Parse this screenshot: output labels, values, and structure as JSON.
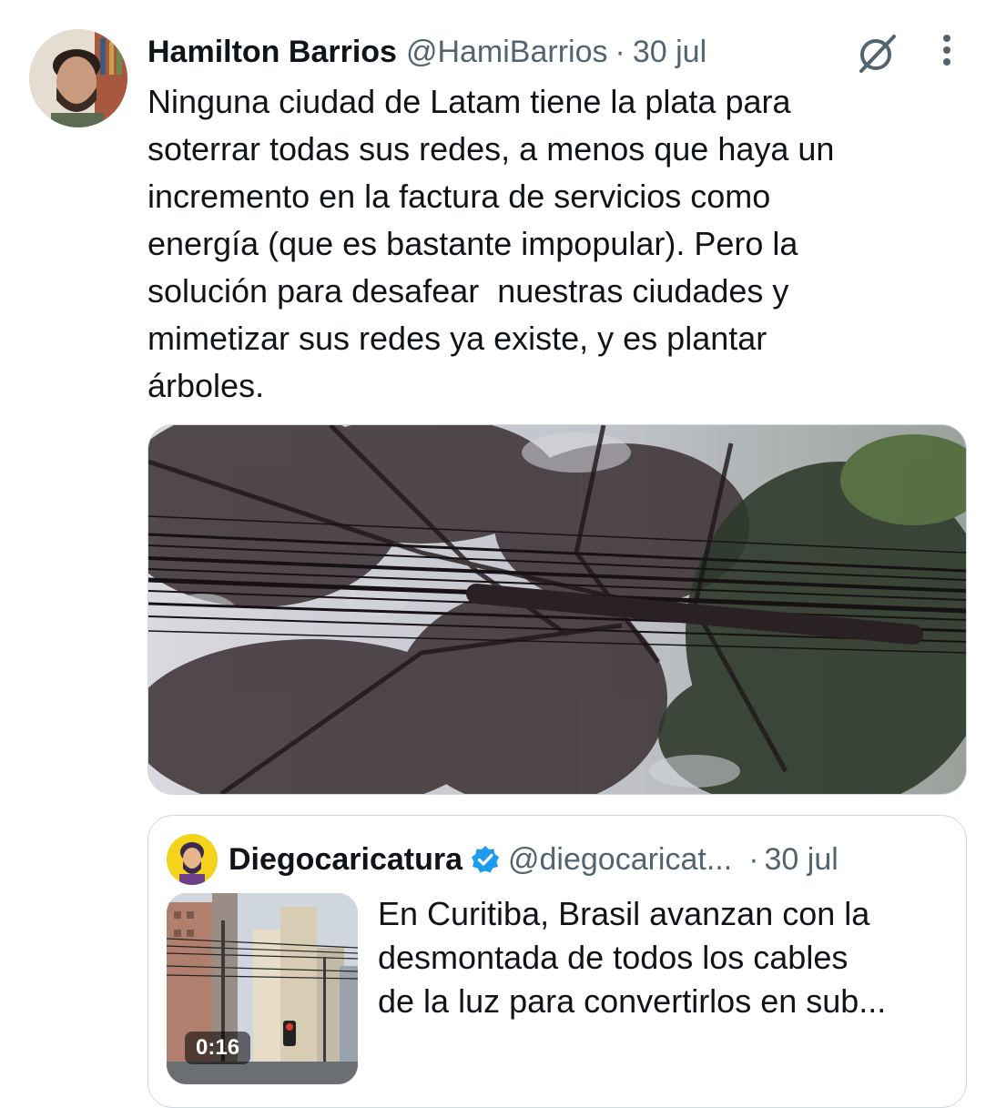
{
  "tweet": {
    "author_name": "Hamilton Barrios",
    "author_handle": "@HamiBarrios",
    "separator": "·",
    "date": "30 jul",
    "text": "Ninguna ciudad de Latam tiene la plata para\nsoterrar todas sus redes, a menos que haya un\nincremento en la factura de servicios como\nenergía (que es bastante impopular). Pero la\nsolución para desafear  nuestras ciudades y\nmimetizar sus redes ya existe, y es plantar\nárboles.",
    "icons": {
      "grok": "grok-icon",
      "more": "more-options-icon"
    },
    "media": {
      "kind": "photo",
      "subject": "trees-and-overhead-cables"
    }
  },
  "quote": {
    "author_name": "Diegocaricatura",
    "verified": true,
    "author_handle": "@diegocaricat...",
    "separator": "·",
    "date": "30 jul",
    "text": "En Curitiba, Brasil avanzan con la\ndesmontada de todos los cables\nde la luz para convertirlos en sub...",
    "video_duration": "0:16",
    "verified_color": "#1d9bf0"
  },
  "colors": {
    "text": "#0f1419",
    "secondary": "#536471",
    "border": "#cfd9de",
    "verified": "#1d9bf0"
  }
}
